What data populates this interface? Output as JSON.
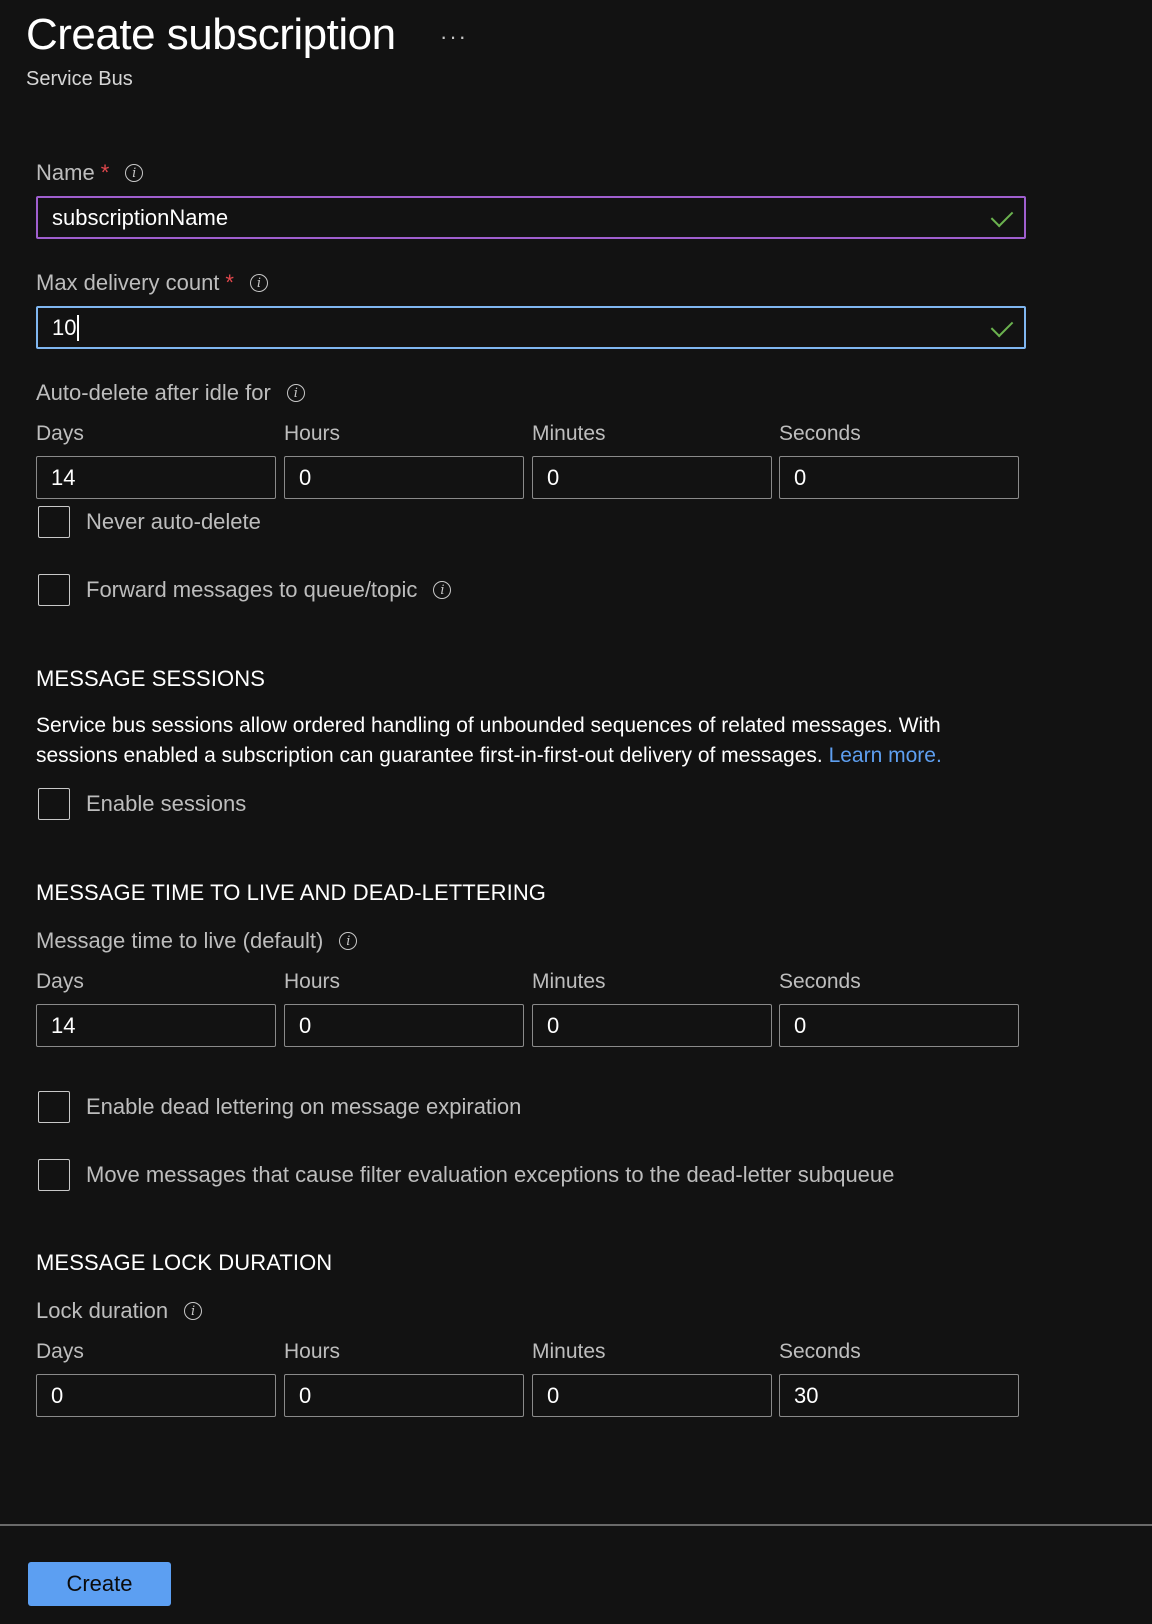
{
  "header": {
    "title": "Create subscription",
    "more_label": "···",
    "subtitle": "Service Bus"
  },
  "name_field": {
    "label": "Name",
    "required_mark": "*",
    "value": "subscriptionName"
  },
  "max_delivery": {
    "label": "Max delivery count",
    "required_mark": "*",
    "value": "10"
  },
  "auto_delete": {
    "label": "Auto-delete after idle for",
    "days_label": "Days",
    "days": "14",
    "hours_label": "Hours",
    "hours": "0",
    "minutes_label": "Minutes",
    "minutes": "0",
    "seconds_label": "Seconds",
    "seconds": "0",
    "never_label": "Never auto-delete"
  },
  "forward": {
    "label": "Forward messages to queue/topic"
  },
  "sessions": {
    "heading": "MESSAGE SESSIONS",
    "description": "Service bus sessions allow ordered handling of unbounded sequences of related messages. With sessions enabled a subscription can guarantee first-in-first-out delivery of messages.",
    "learn_more": "Learn more.",
    "enable_label": "Enable sessions"
  },
  "ttl": {
    "heading": "MESSAGE TIME TO LIVE AND DEAD-LETTERING",
    "label": "Message time to live (default)",
    "days_label": "Days",
    "days": "14",
    "hours_label": "Hours",
    "hours": "0",
    "minutes_label": "Minutes",
    "minutes": "0",
    "seconds_label": "Seconds",
    "seconds": "0",
    "dead_letter_label": "Enable dead lettering on message expiration",
    "filter_exceptions_label": "Move messages that cause filter evaluation exceptions to the dead-letter subqueue"
  },
  "lock": {
    "heading": "MESSAGE LOCK DURATION",
    "label": "Lock duration",
    "days_label": "Days",
    "days": "0",
    "hours_label": "Hours",
    "hours": "0",
    "minutes_label": "Minutes",
    "minutes": "0",
    "seconds_label": "Seconds",
    "seconds": "30"
  },
  "footer": {
    "create_label": "Create"
  },
  "colors": {
    "background": "#121212",
    "accent_button": "#5c9ff2",
    "link": "#5e9ff0",
    "required": "#e0474c",
    "valid_check": "#6bb24f",
    "focus_border": "#7fb6f0",
    "name_border": "#9f5fcf"
  }
}
